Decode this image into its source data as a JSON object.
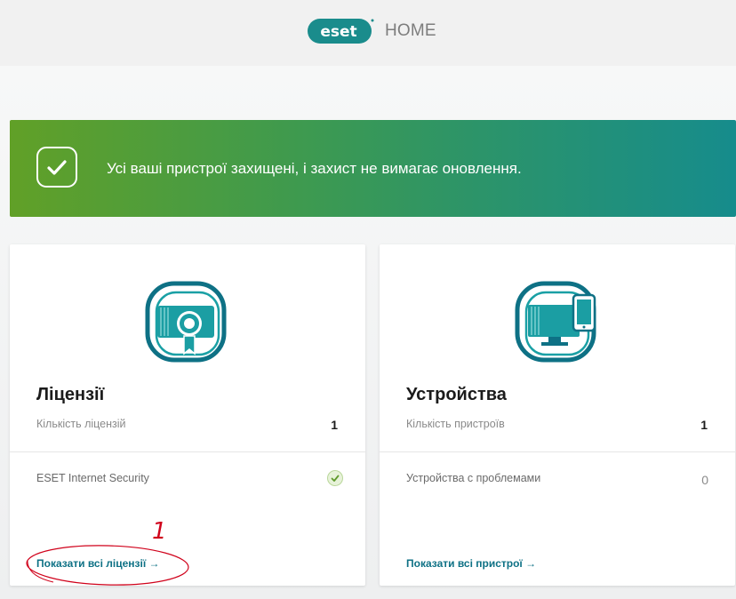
{
  "header": {
    "logo_text": "eset",
    "home_label": "HOME"
  },
  "banner": {
    "message": "Усі ваші пристрої захищені, і захист не вимагає оновлення."
  },
  "licenses_card": {
    "icon": "license-certificate-icon",
    "title": "Ліцензії",
    "count_label": "Кількість ліцензій",
    "count_value": "1",
    "item_name": "ESET Internet Security",
    "item_status_icon": "check-icon",
    "link_label": "Показати всі ліцензії →"
  },
  "devices_card": {
    "icon": "devices-icon",
    "title": "Устройства",
    "count_label": "Кількість пристроїв",
    "count_value": "1",
    "problems_label": "Устройства с проблемами",
    "problems_value": "0",
    "link_label": "Показати всі пристрої →"
  },
  "annotation": {
    "mark": "1",
    "color": "#d0021b"
  },
  "colors": {
    "accent": "#0e7185",
    "banner_start": "#61a027",
    "banner_end": "#168c8c"
  }
}
